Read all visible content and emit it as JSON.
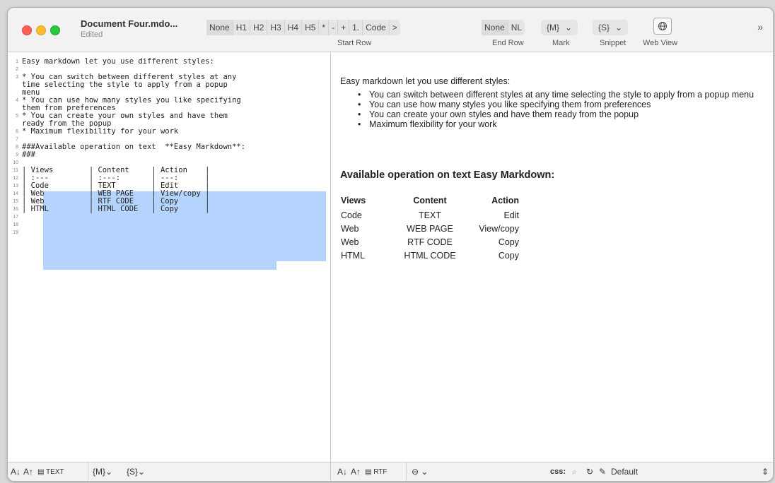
{
  "window": {
    "title": "Document Four.mdo...",
    "subtitle": "Edited"
  },
  "toolbar": {
    "start_row_buttons": [
      "None",
      "H1",
      "H2",
      "H3",
      "H4",
      "H5",
      "*",
      "-",
      "+",
      "1.",
      "Code",
      ">"
    ],
    "start_row_label": "Start Row",
    "end_row_buttons": [
      "None",
      "NL"
    ],
    "end_row_label": "End Row",
    "mark_value": "{M}",
    "mark_label": "Mark",
    "snippet_value": "{S}",
    "snippet_label": "Snippet",
    "webview_label": "Web View",
    "more_icon": "»",
    "chevron": "⌄"
  },
  "editor": {
    "lines": [
      {
        "n": "1",
        "t": "Easy markdown let you use different styles:"
      },
      {
        "n": "2",
        "t": ""
      },
      {
        "n": "3",
        "t": "* You can switch between different styles at any"
      },
      {
        "n": "",
        "t": "time selecting the style to apply from a popup"
      },
      {
        "n": "",
        "t": "menu"
      },
      {
        "n": "4",
        "t": "* You can use how many styles you like specifying"
      },
      {
        "n": "",
        "t": "them from preferences"
      },
      {
        "n": "5",
        "t": "* You can create your own styles and have them"
      },
      {
        "n": "",
        "t": "ready from the popup"
      },
      {
        "n": "6",
        "t": "* Maximum flexibility for your work"
      },
      {
        "n": "7",
        "t": ""
      },
      {
        "n": "8",
        "t": "###Available operation on text  **Easy Markdown**:"
      },
      {
        "n": "9",
        "t": "###"
      },
      {
        "n": "10",
        "t": ""
      },
      {
        "n": "11",
        "t": "| Views        | Content     | Action    |"
      },
      {
        "n": "12",
        "t": "| :---         | :---:       | ---:      |"
      },
      {
        "n": "13",
        "t": "| Code         | TEXT        | Edit      |"
      },
      {
        "n": "14",
        "t": "| Web          | WEB PAGE    | View/copy |"
      },
      {
        "n": "15",
        "t": "| Web          | RTF CODE    | Copy      |"
      },
      {
        "n": "16",
        "t": "| HTML         | HTML CODE   | Copy      |"
      },
      {
        "n": "17",
        "t": ""
      },
      {
        "n": "18",
        "t": ""
      },
      {
        "n": "19",
        "t": ""
      }
    ]
  },
  "preview": {
    "intro": "Easy markdown let you use different styles:",
    "bullets": [
      "You can switch between different styles at any time selecting the style to apply from a popup menu",
      "You can use how many styles you like specifying them from preferences",
      "You can create your own styles and have them ready from the popup",
      "Maximum flexibility for your work"
    ],
    "heading": "Available operation on text Easy Markdown:",
    "table": {
      "headers": [
        "Views",
        "Content",
        "Action"
      ],
      "rows": [
        [
          "Code",
          "TEXT",
          "Edit"
        ],
        [
          "Web",
          "WEB PAGE",
          "View/copy"
        ],
        [
          "Web",
          "RTF CODE",
          "Copy"
        ],
        [
          "HTML",
          "HTML CODE",
          "Copy"
        ]
      ]
    }
  },
  "bottombar_left": {
    "sort_asc": "A↓",
    "sort_desc": "A↑",
    "text_label": "TEXT",
    "mark": "{M}",
    "snippet": "{S}",
    "chevron": "⌄"
  },
  "bottombar_right": {
    "sort_asc": "A↓",
    "sort_desc": "A↑",
    "rtf_label": "RTF",
    "more_icon": "⊖",
    "chevron": "⌄",
    "css_label": "css:",
    "css_value": "Default",
    "stepper": "⇕"
  }
}
